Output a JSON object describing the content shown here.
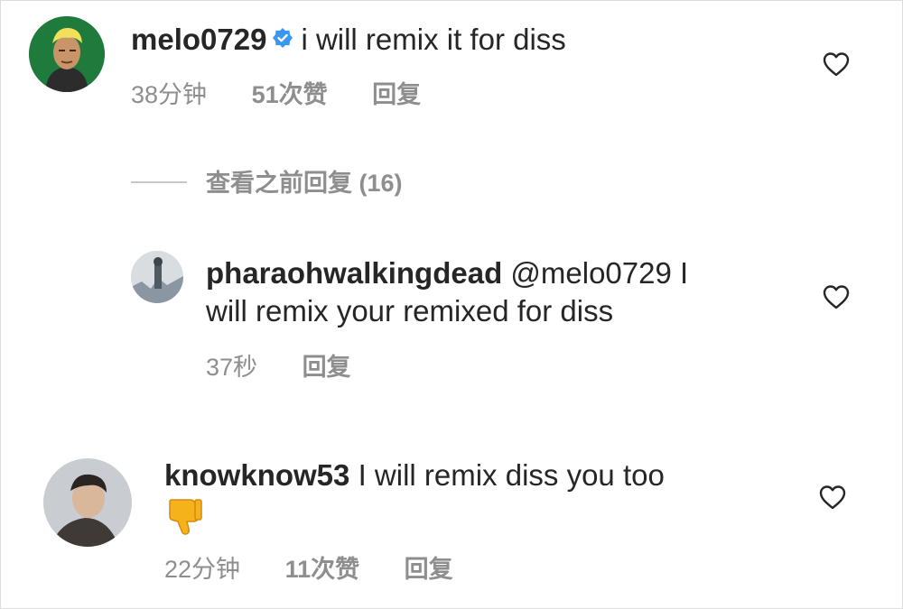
{
  "comments": [
    {
      "username": "melo0729",
      "verified": true,
      "text": "i will remix it for diss",
      "time": "38分钟",
      "likes": "51次赞",
      "reply_label": "回复"
    },
    {
      "username": "pharaohwalkingdead",
      "mention": "@melo0729",
      "text_line1_tail": "I",
      "text_line2": "will remix your remixed for diss",
      "time": "37秒",
      "reply_label": "回复"
    },
    {
      "username": "knowknow53",
      "text": "I will remix diss you too",
      "emoji": "thumbs-down",
      "time": "22分钟",
      "likes": "11次赞",
      "reply_label": "回复"
    }
  ],
  "view_previous_replies": "查看之前回复 (16)",
  "icons": {
    "verified_badge": "verified-badge-icon",
    "like": "heart-outline-icon",
    "emoji": "thumbs-down-emoji"
  },
  "colors": {
    "text": "#262626",
    "meta": "#8e8e8e",
    "verified": "#3897f0",
    "emoji": "#f5b21b"
  }
}
